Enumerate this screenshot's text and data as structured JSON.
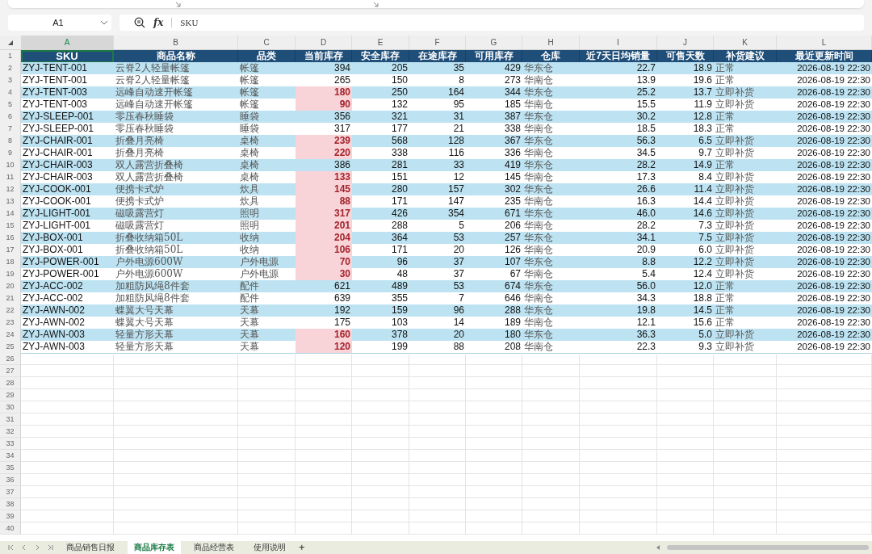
{
  "formula_bar": {
    "name_box": "A1",
    "fx_label": "fx",
    "formula": "SKU"
  },
  "column_letters": [
    {
      "label": "A",
      "selected": true
    },
    {
      "label": "B",
      "selected": false
    },
    {
      "label": "C",
      "selected": false
    },
    {
      "label": "D",
      "selected": false
    },
    {
      "label": "E",
      "selected": false
    },
    {
      "label": "F",
      "selected": false
    },
    {
      "label": "G",
      "selected": false
    },
    {
      "label": "H",
      "selected": false
    },
    {
      "label": "I",
      "selected": false
    },
    {
      "label": "J",
      "selected": false
    },
    {
      "label": "K",
      "selected": false
    },
    {
      "label": "L",
      "selected": false
    }
  ],
  "table": {
    "header_row": "1",
    "columns": [
      "SKU",
      "商品名称",
      "品类",
      "当前库存",
      "安全库存",
      "在途库存",
      "可用库存",
      "仓库",
      "近7天日均销量",
      "可售天数",
      "补货建议",
      "最近更新时间"
    ],
    "rows": [
      {
        "row": "2",
        "cells": [
          "ZYJ-TENT-001",
          "云脊2人轻量帐篷",
          "帐篷",
          "394",
          "205",
          "35",
          "429",
          "华东仓",
          "22.7",
          "18.9",
          "正常",
          "2026-08-19 22:30"
        ],
        "low_stock": false
      },
      {
        "row": "3",
        "cells": [
          "ZYJ-TENT-001",
          "云脊2人轻量帐篷",
          "帐篷",
          "265",
          "150",
          "8",
          "273",
          "华南仓",
          "13.9",
          "19.6",
          "正常",
          "2026-08-19 22:30"
        ],
        "low_stock": false
      },
      {
        "row": "4",
        "cells": [
          "ZYJ-TENT-003",
          "远峰自动速开帐篷",
          "帐篷",
          "180",
          "250",
          "164",
          "344",
          "华东仓",
          "25.2",
          "13.7",
          "立即补货",
          "2026-08-19 22:30"
        ],
        "low_stock": true
      },
      {
        "row": "5",
        "cells": [
          "ZYJ-TENT-003",
          "远峰自动速开帐篷",
          "帐篷",
          "90",
          "132",
          "95",
          "185",
          "华南仓",
          "15.5",
          "11.9",
          "立即补货",
          "2026-08-19 22:30"
        ],
        "low_stock": true
      },
      {
        "row": "6",
        "cells": [
          "ZYJ-SLEEP-001",
          "零压春秋睡袋",
          "睡袋",
          "356",
          "321",
          "31",
          "387",
          "华东仓",
          "30.2",
          "12.8",
          "正常",
          "2026-08-19 22:30"
        ],
        "low_stock": false
      },
      {
        "row": "7",
        "cells": [
          "ZYJ-SLEEP-001",
          "零压春秋睡袋",
          "睡袋",
          "317",
          "177",
          "21",
          "338",
          "华南仓",
          "18.5",
          "18.3",
          "正常",
          "2026-08-19 22:30"
        ],
        "low_stock": false
      },
      {
        "row": "8",
        "cells": [
          "ZYJ-CHAIR-001",
          "折叠月亮椅",
          "桌椅",
          "239",
          "568",
          "128",
          "367",
          "华东仓",
          "56.3",
          "6.5",
          "立即补货",
          "2026-08-19 22:30"
        ],
        "low_stock": true
      },
      {
        "row": "9",
        "cells": [
          "ZYJ-CHAIR-001",
          "折叠月亮椅",
          "桌椅",
          "220",
          "338",
          "116",
          "336",
          "华南仓",
          "34.5",
          "9.7",
          "立即补货",
          "2026-08-19 22:30"
        ],
        "low_stock": true
      },
      {
        "row": "10",
        "cells": [
          "ZYJ-CHAIR-003",
          "双人露营折叠椅",
          "桌椅",
          "386",
          "281",
          "33",
          "419",
          "华东仓",
          "28.2",
          "14.9",
          "正常",
          "2026-08-19 22:30"
        ],
        "low_stock": false
      },
      {
        "row": "11",
        "cells": [
          "ZYJ-CHAIR-003",
          "双人露营折叠椅",
          "桌椅",
          "133",
          "151",
          "12",
          "145",
          "华南仓",
          "17.3",
          "8.4",
          "立即补货",
          "2026-08-19 22:30"
        ],
        "low_stock": true
      },
      {
        "row": "12",
        "cells": [
          "ZYJ-COOK-001",
          "便携卡式炉",
          "炊具",
          "145",
          "280",
          "157",
          "302",
          "华东仓",
          "26.6",
          "11.4",
          "立即补货",
          "2026-08-19 22:30"
        ],
        "low_stock": true
      },
      {
        "row": "13",
        "cells": [
          "ZYJ-COOK-001",
          "便携卡式炉",
          "炊具",
          "88",
          "171",
          "147",
          "235",
          "华南仓",
          "16.3",
          "14.4",
          "立即补货",
          "2026-08-19 22:30"
        ],
        "low_stock": true
      },
      {
        "row": "14",
        "cells": [
          "ZYJ-LIGHT-001",
          "磁吸露营灯",
          "照明",
          "317",
          "426",
          "354",
          "671",
          "华东仓",
          "46.0",
          "14.6",
          "立即补货",
          "2026-08-19 22:30"
        ],
        "low_stock": true
      },
      {
        "row": "15",
        "cells": [
          "ZYJ-LIGHT-001",
          "磁吸露营灯",
          "照明",
          "201",
          "288",
          "5",
          "206",
          "华南仓",
          "28.2",
          "7.3",
          "立即补货",
          "2026-08-19 22:30"
        ],
        "low_stock": true
      },
      {
        "row": "16",
        "cells": [
          "ZYJ-BOX-001",
          "折叠收纳箱50L",
          "收纳",
          "204",
          "364",
          "53",
          "257",
          "华东仓",
          "34.1",
          "7.5",
          "立即补货",
          "2026-08-19 22:30"
        ],
        "low_stock": true
      },
      {
        "row": "17",
        "cells": [
          "ZYJ-BOX-001",
          "折叠收纳箱50L",
          "收纳",
          "106",
          "171",
          "20",
          "126",
          "华南仓",
          "20.9",
          "6.0",
          "立即补货",
          "2026-08-19 22:30"
        ],
        "low_stock": true
      },
      {
        "row": "18",
        "cells": [
          "ZYJ-POWER-001",
          "户外电源600W",
          "户外电源",
          "70",
          "96",
          "37",
          "107",
          "华东仓",
          "8.8",
          "12.2",
          "立即补货",
          "2026-08-19 22:30"
        ],
        "low_stock": true
      },
      {
        "row": "19",
        "cells": [
          "ZYJ-POWER-001",
          "户外电源600W",
          "户外电源",
          "30",
          "48",
          "37",
          "67",
          "华南仓",
          "5.4",
          "12.4",
          "立即补货",
          "2026-08-19 22:30"
        ],
        "low_stock": true
      },
      {
        "row": "20",
        "cells": [
          "ZYJ-ACC-002",
          "加粗防风绳8件套",
          "配件",
          "621",
          "489",
          "53",
          "674",
          "华东仓",
          "56.0",
          "12.0",
          "正常",
          "2026-08-19 22:30"
        ],
        "low_stock": false
      },
      {
        "row": "21",
        "cells": [
          "ZYJ-ACC-002",
          "加粗防风绳8件套",
          "配件",
          "639",
          "355",
          "7",
          "646",
          "华南仓",
          "34.3",
          "18.8",
          "正常",
          "2026-08-19 22:30"
        ],
        "low_stock": false
      },
      {
        "row": "22",
        "cells": [
          "ZYJ-AWN-002",
          "蝶翼大号天幕",
          "天幕",
          "192",
          "159",
          "96",
          "288",
          "华东仓",
          "19.8",
          "14.5",
          "正常",
          "2026-08-19 22:30"
        ],
        "low_stock": false
      },
      {
        "row": "23",
        "cells": [
          "ZYJ-AWN-002",
          "蝶翼大号天幕",
          "天幕",
          "175",
          "103",
          "14",
          "189",
          "华南仓",
          "12.1",
          "15.6",
          "正常",
          "2026-08-19 22:30"
        ],
        "low_stock": false
      },
      {
        "row": "24",
        "cells": [
          "ZYJ-AWN-003",
          "轻量方形天幕",
          "天幕",
          "160",
          "378",
          "20",
          "180",
          "华东仓",
          "36.3",
          "5.0",
          "立即补货",
          "2026-08-19 22:30"
        ],
        "low_stock": true
      },
      {
        "row": "25",
        "cells": [
          "ZYJ-AWN-003",
          "轻量方形天幕",
          "天幕",
          "120",
          "199",
          "88",
          "208",
          "华南仓",
          "22.3",
          "9.3",
          "立即补货",
          "2026-08-19 22:30"
        ],
        "low_stock": true
      }
    ]
  },
  "empty_rows": [
    "26",
    "27",
    "28",
    "29",
    "30",
    "31",
    "32",
    "33",
    "34",
    "35",
    "36",
    "37",
    "38",
    "39",
    "40"
  ],
  "sheet_tabs": [
    {
      "label": "商品销售日报",
      "selected": false
    },
    {
      "label": "商品库存表",
      "selected": true
    },
    {
      "label": "商品经营表",
      "selected": false
    },
    {
      "label": "使用说明",
      "selected": false
    }
  ],
  "add_sheet": "+"
}
